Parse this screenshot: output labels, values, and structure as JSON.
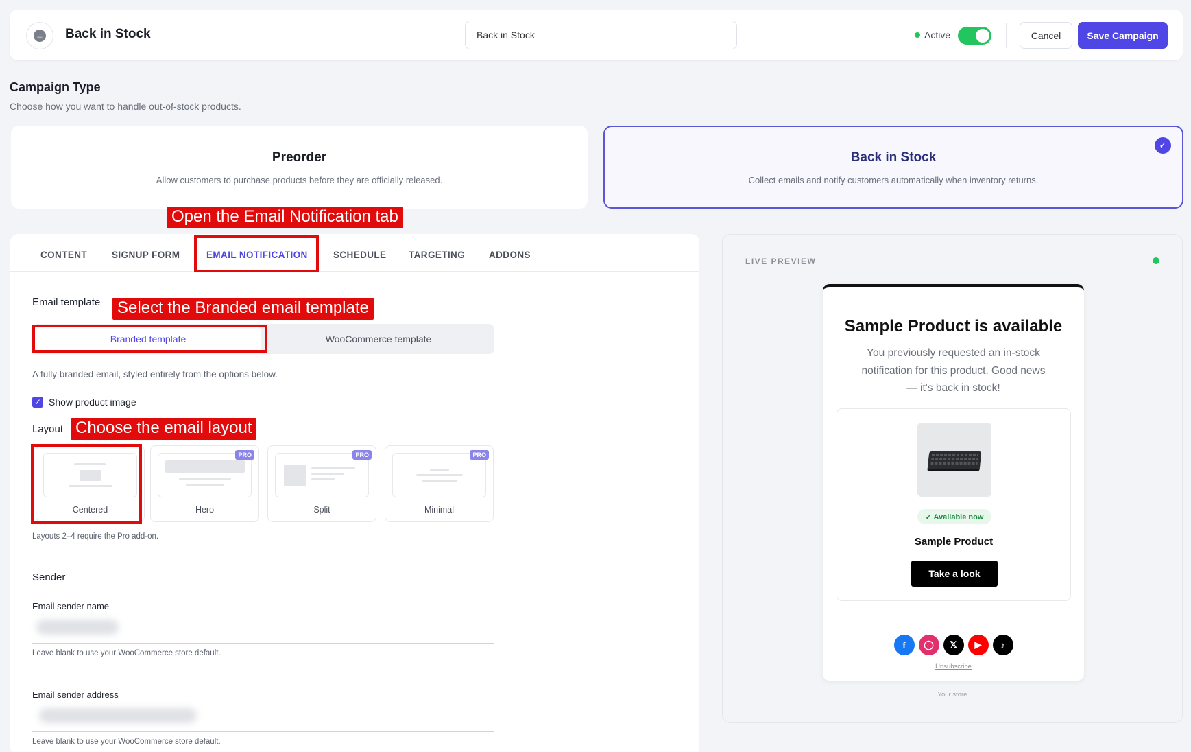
{
  "header": {
    "title": "Back in Stock",
    "campaign_name": "Back in Stock",
    "status_label": "Active",
    "cancel_label": "Cancel",
    "save_label": "Save Campaign"
  },
  "campaign_type": {
    "title": "Campaign Type",
    "subtitle": "Choose how you want to handle out-of-stock products.",
    "options": [
      {
        "title": "Preorder",
        "desc": "Allow customers to purchase products before they are officially released."
      },
      {
        "title": "Back in Stock",
        "desc": "Collect emails and notify customers automatically when inventory returns."
      }
    ]
  },
  "annotations": {
    "tab": "Open the Email Notification tab",
    "template": "Select the Branded email template",
    "layout": "Choose the email layout"
  },
  "tabs": [
    "CONTENT",
    "SIGNUP FORM",
    "EMAIL NOTIFICATION",
    "SCHEDULE",
    "TARGETING",
    "ADDONS"
  ],
  "email_template": {
    "label": "Email template",
    "options": [
      "Branded template",
      "WooCommerce template"
    ],
    "help": "A fully branded email, styled entirely from the options below.",
    "show_image_label": "Show product image"
  },
  "layout": {
    "label": "Layout",
    "pro_badge": "PRO",
    "options": [
      "Centered",
      "Hero",
      "Split",
      "Minimal"
    ],
    "help": "Layouts 2–4 require the Pro add-on."
  },
  "sender": {
    "title": "Sender",
    "name_label": "Email sender name",
    "name_help": "Leave blank to use your WooCommerce store default.",
    "address_label": "Email sender address",
    "address_help": "Leave blank to use your WooCommerce store default."
  },
  "preview": {
    "label": "LIVE PREVIEW",
    "email_title": "Sample Product is available",
    "email_body": "You previously requested an in-stock notification for this product. Good news — it's back in stock!",
    "badge": "✓ Available now",
    "product_name": "Sample Product",
    "cta": "Take a look",
    "unsubscribe": "Unsubscribe",
    "store": "Your store"
  },
  "colors": {
    "accent": "#4f46e5",
    "active_green": "#22c55e",
    "annotation_red": "#e20b0b"
  },
  "icons": [
    "back-arrow-icon",
    "check-icon",
    "facebook-icon",
    "instagram-icon",
    "x-icon",
    "youtube-icon",
    "tiktok-icon"
  ]
}
